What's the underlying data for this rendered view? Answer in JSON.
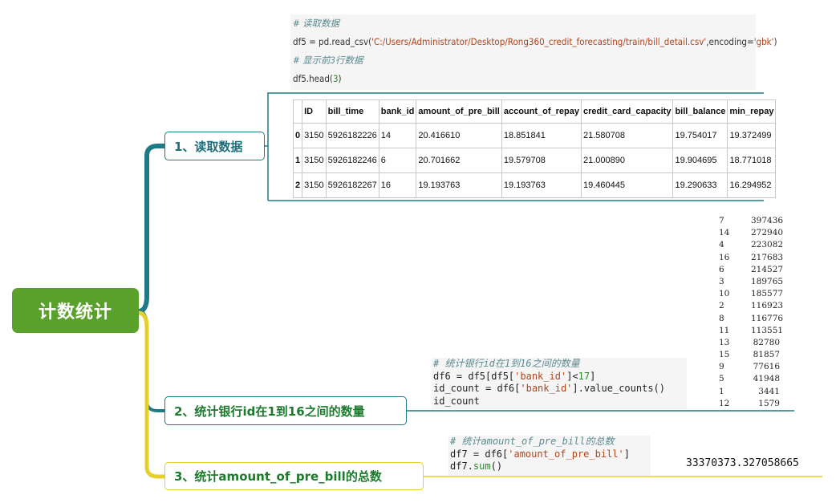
{
  "root": {
    "label": "计数统计"
  },
  "colors": {
    "root_bg": "#5aa12c",
    "teal": "#1e7b86",
    "yellow": "#e6cf2a",
    "green_text": "#1c7a2c"
  },
  "branches": [
    {
      "label": "1、读取数据"
    },
    {
      "label": "2、统计银行id在1到16之间的数量"
    },
    {
      "label": "3、统计amount_of_pre_bill的总数"
    }
  ],
  "code1": {
    "comment1": "# 读取数据",
    "line1_prefix": "df5 = pd.read_csv(",
    "line1_str": "'C:/Users/Administrator/Desktop/Rong360_credit_forecasting/train/bill_detail.csv'",
    "line1_mid": ",encoding=",
    "line1_enc": "'gbk'",
    "line1_end": ")",
    "comment2": "# 显示前3行数据",
    "line2_prefix": "df5.head(",
    "line2_num": "3",
    "line2_end": ")"
  },
  "table": {
    "headers": [
      "",
      "ID",
      "bill_time",
      "bank_id",
      "amount_of_pre_bill",
      "account_of_repay",
      "credit_card_capacity",
      "bill_balance",
      "min_repay"
    ],
    "rows": [
      [
        "0",
        "3150",
        "5926182226",
        "14",
        "20.416610",
        "18.851841",
        "21.580708",
        "19.754017",
        "19.372499"
      ],
      [
        "1",
        "3150",
        "5926182246",
        "6",
        "20.701662",
        "19.579708",
        "21.000890",
        "19.904695",
        "18.771018"
      ],
      [
        "2",
        "3150",
        "5926182267",
        "16",
        "19.193763",
        "19.193763",
        "19.460445",
        "19.290633",
        "16.294952"
      ]
    ]
  },
  "code2": {
    "comment": "# 统计银行id在1到16之间的数量",
    "l1_a": "df6 = df5[df5[",
    "l1_str": "'bank_id'",
    "l1_b": "]<",
    "l1_num": "17",
    "l1_c": "]",
    "l2_a": "id_count = df6[",
    "l2_str": "'bank_id'",
    "l2_b": "].value_counts()",
    "l3": "id_count"
  },
  "value_counts": [
    [
      "7",
      "397436"
    ],
    [
      "14",
      "272940"
    ],
    [
      "4",
      "223082"
    ],
    [
      "16",
      "217683"
    ],
    [
      "6",
      "214527"
    ],
    [
      "3",
      "189765"
    ],
    [
      "10",
      "185577"
    ],
    [
      "2",
      "116923"
    ],
    [
      "8",
      "116776"
    ],
    [
      "11",
      "113551"
    ],
    [
      "13",
      "82780"
    ],
    [
      "15",
      "81857"
    ],
    [
      "9",
      "77616"
    ],
    [
      "5",
      "41948"
    ],
    [
      "1",
      "3441"
    ],
    [
      "12",
      "1579"
    ]
  ],
  "code3": {
    "comment": "# 统计amount_of_pre_bill的总数",
    "l1_a": "df7 = df6[",
    "l1_str": "'amount_of_pre_bill'",
    "l1_b": "]",
    "l2_a": "df7.",
    "l2_fn": "sum",
    "l2_b": "()"
  },
  "total": "33370373.327058665"
}
